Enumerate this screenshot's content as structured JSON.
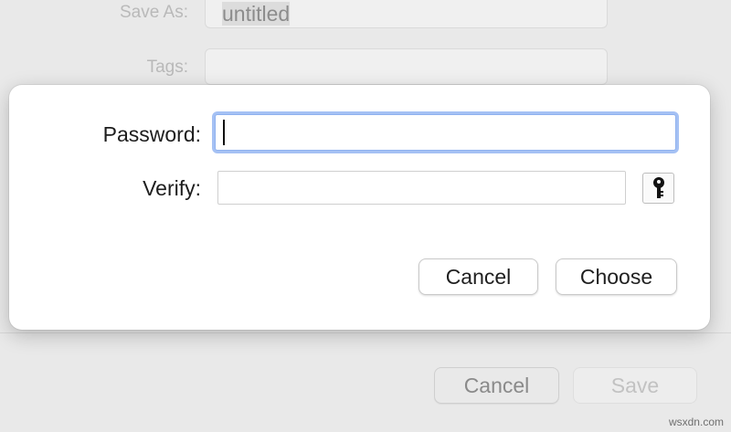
{
  "background_panel": {
    "save_as_label": "Save As:",
    "save_as_value": "untitled",
    "tags_label": "Tags:",
    "tags_value": "",
    "cancel_label": "Cancel",
    "save_label": "Save"
  },
  "password_sheet": {
    "password_label": "Password:",
    "password_value": "",
    "verify_label": "Verify:",
    "verify_value": "",
    "key_button_icon": "key-icon",
    "cancel_label": "Cancel",
    "choose_label": "Choose"
  },
  "colors": {
    "focus_ring": "#75a0ee",
    "sheet_bg": "#ffffff",
    "dimmed_bg": "#e9e9e9"
  },
  "watermark": "wsxdn.com"
}
